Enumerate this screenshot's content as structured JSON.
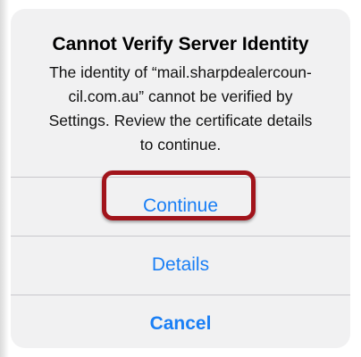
{
  "alert": {
    "title": "Cannot Verify Server Identity",
    "message_lines": [
      "The identity of “mail.sharpdealercoun-",
      "cil.com.au” cannot be verified by",
      "Settings. Review the certificate details",
      "to continue."
    ],
    "actions": {
      "continue_label": "Continue",
      "details_label": "Details",
      "cancel_label": "Cancel"
    }
  },
  "colors": {
    "action_blue": "#1a7ff5",
    "highlight_red": "#a1141b",
    "alert_background": "#f1f1f2"
  }
}
